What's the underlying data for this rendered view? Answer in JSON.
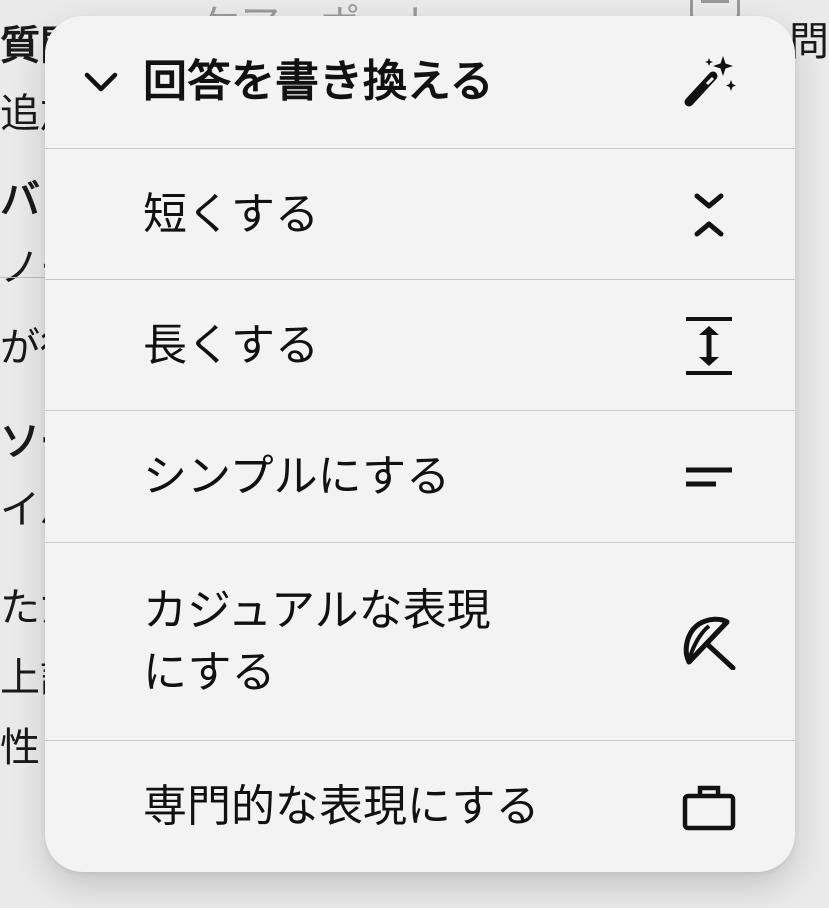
{
  "background": {
    "top_fragment": "ケア・ポート",
    "right_fragment": "問",
    "left_fragments": [
      "質問",
      "追加",
      "バッ",
      "ノー",
      "が得",
      "ソー",
      "イバ",
      "ただ",
      "上記",
      "性と"
    ]
  },
  "menu": {
    "header": {
      "label": "回答を書き換える",
      "chevron_icon": "chevron-down-icon",
      "icon": "magic-wand-icon"
    },
    "items": [
      {
        "label": "短くする",
        "icon": "compress-icon"
      },
      {
        "label": "長くする",
        "icon": "expand-icon"
      },
      {
        "label": "シンプルにする",
        "icon": "short-lines-icon"
      },
      {
        "label": "カジュアルな表現\nにする",
        "icon": "beach-umbrella-icon"
      },
      {
        "label": "専門的な表現にする",
        "icon": "briefcase-icon"
      }
    ]
  },
  "colors": {
    "menu_background": "#f3f3f3",
    "divider": "#c9c9c9",
    "text": "#111111",
    "page_background": "#eaeaea"
  }
}
